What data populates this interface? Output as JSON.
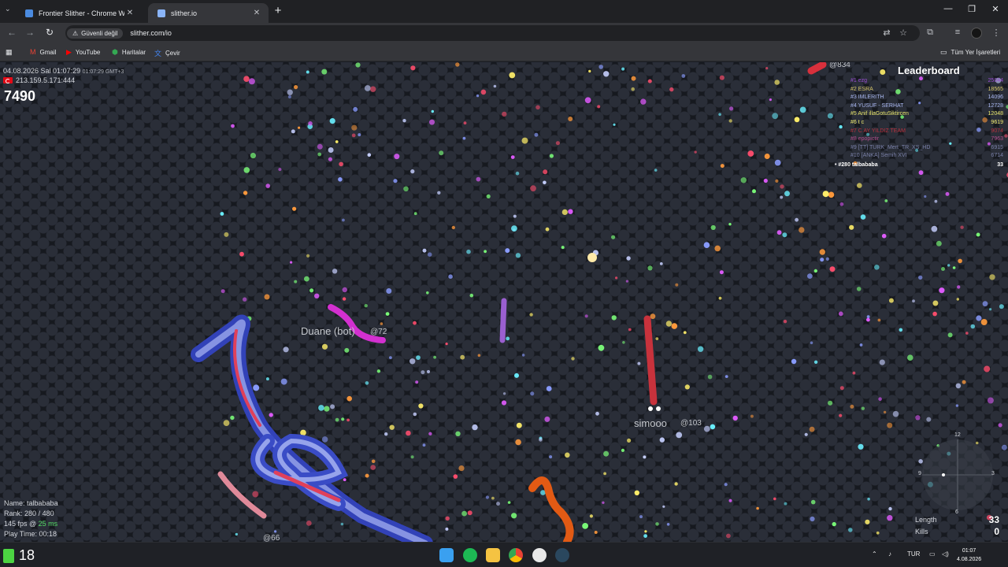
{
  "browser": {
    "tabs": [
      {
        "label": "Frontier Slither - Chrome Web M",
        "active": false
      },
      {
        "label": "slither.io",
        "active": true
      }
    ],
    "security_label": "Güvenli değil",
    "url": "slither.com/io",
    "bookmarks": [
      {
        "label": "Gmail",
        "icon": "gmail-icon"
      },
      {
        "label": "YouTube",
        "icon": "youtube-icon"
      },
      {
        "label": "Haritalar",
        "icon": "maps-icon"
      },
      {
        "label": "Çevir",
        "icon": "translate-icon"
      }
    ],
    "all_bookmarks": "Tüm Yer İşaretleri"
  },
  "game": {
    "datetime": "04.08.2026 Sal 01:07:29",
    "datetime_tz": "01:07:29 GMT+3",
    "server_ip": "213.159.5.171:444",
    "score": "7490",
    "leaderboard_title": "Leaderboard",
    "leaderboard": [
      {
        "name": "#1 ezg",
        "score": "25044",
        "color": "#9a4fd4"
      },
      {
        "name": "#2 ESRA",
        "score": "18565",
        "color": "#d9c86a"
      },
      {
        "name": "#3 IMLERITH",
        "score": "14096",
        "color": "#a9b7f0"
      },
      {
        "name": "#4 YUSUF - SERHAT",
        "score": "12728",
        "color": "#a9b7f0"
      },
      {
        "name": "#5 Anif illaGotuSiktircen",
        "score": "12048",
        "color": "#e9e66d"
      },
      {
        "name": "#6 t c",
        "score": "9619",
        "color": "#f4ef71"
      },
      {
        "name": "#7 C AY YILDIZ TEAM",
        "score": "9074",
        "color": "#b8323e"
      },
      {
        "name": "#8 epopictir",
        "score": "7963",
        "color": "#b04f8c"
      },
      {
        "name": "#9 [TT] TURK_Mert_TR_XS_HD",
        "score": "6915",
        "color": "#7a80a8"
      },
      {
        "name": "#10 [ANKA] Semih XVI",
        "score": "6714",
        "color": "#7a80a8"
      }
    ],
    "self_rank_row": {
      "name": "#280 talbababa",
      "score": "33"
    },
    "snakes": [
      {
        "name": "Duane (bot)",
        "tag": "@72"
      },
      {
        "name": "simooo",
        "tag": "@103"
      }
    ],
    "other_tags": [
      "@834",
      "@66"
    ],
    "stats": {
      "name_label": "Name:",
      "name": "talbababa",
      "rank_label": "Rank:",
      "rank": "280",
      "rank_total": "480",
      "fps": "145 fps",
      "ping": "25 ms",
      "playtime_label": "Play Time:",
      "playtime": "00:18"
    },
    "length_label": "Length",
    "length": "33",
    "kills_label": "Kills",
    "kills": "0",
    "minimap_number": "12",
    "minimap_side_labels": [
      "9",
      "3",
      "6"
    ]
  },
  "taskbar": {
    "left_number": "18",
    "lang": "TUR",
    "time": "01:07",
    "date": "4.08.2026"
  }
}
